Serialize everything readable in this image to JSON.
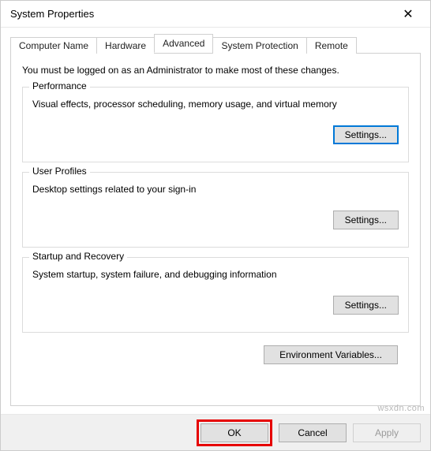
{
  "window": {
    "title": "System Properties",
    "close_glyph": "✕"
  },
  "tabs": {
    "t0": "Computer Name",
    "t1": "Hardware",
    "t2": "Advanced",
    "t3": "System Protection",
    "t4": "Remote"
  },
  "intro": "You must be logged on as an Administrator to make most of these changes.",
  "performance": {
    "legend": "Performance",
    "desc": "Visual effects, processor scheduling, memory usage, and virtual memory",
    "button": "Settings..."
  },
  "profiles": {
    "legend": "User Profiles",
    "desc": "Desktop settings related to your sign-in",
    "button": "Settings..."
  },
  "startup": {
    "legend": "Startup and Recovery",
    "desc": "System startup, system failure, and debugging information",
    "button": "Settings..."
  },
  "env_button": "Environment Variables...",
  "footer": {
    "ok": "OK",
    "cancel": "Cancel",
    "apply": "Apply"
  },
  "watermark": "wsxdn.com"
}
